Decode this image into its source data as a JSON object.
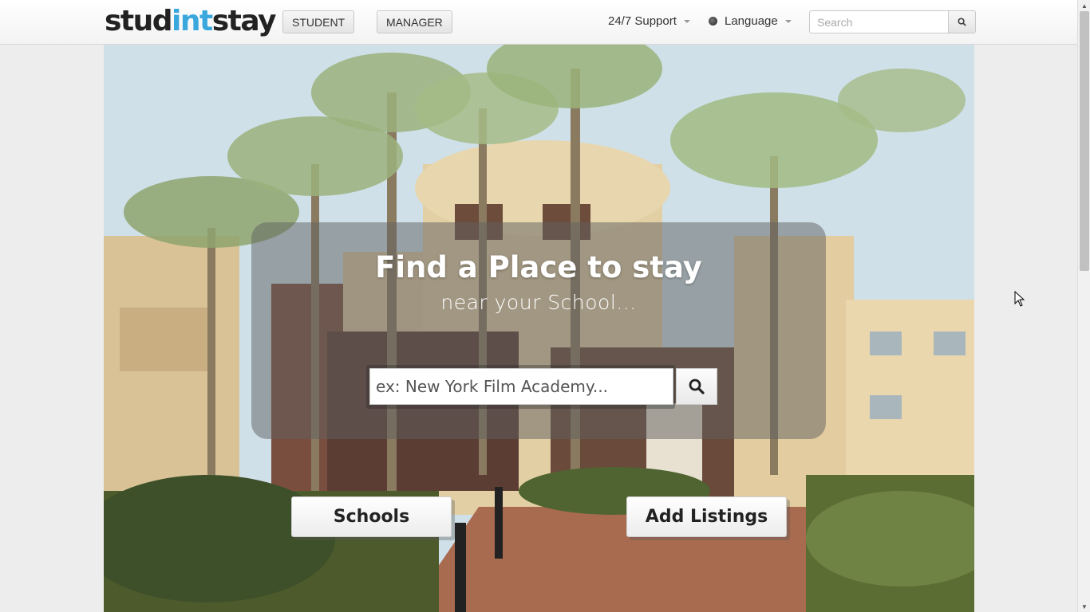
{
  "header": {
    "logo_part1": "stud",
    "logo_part2": "int",
    "logo_part3": "stay",
    "nav_student": "STUDENT",
    "nav_manager": "MANAGER",
    "support_label": "24/7 Support",
    "language_label": "Language",
    "search_placeholder": "Search",
    "icons": {
      "search": "search-icon",
      "globe": "globe-icon",
      "caret": "caret-down-icon"
    }
  },
  "hero": {
    "title": "Find a Place to stay",
    "subtitle": "near your School...",
    "search_placeholder": "ex: New York Film Academy...",
    "schools_button": "Schools",
    "add_listings_button": "Add Listings"
  },
  "colors": {
    "logo_accent": "#3aa7dd",
    "logo_text": "#222222"
  }
}
